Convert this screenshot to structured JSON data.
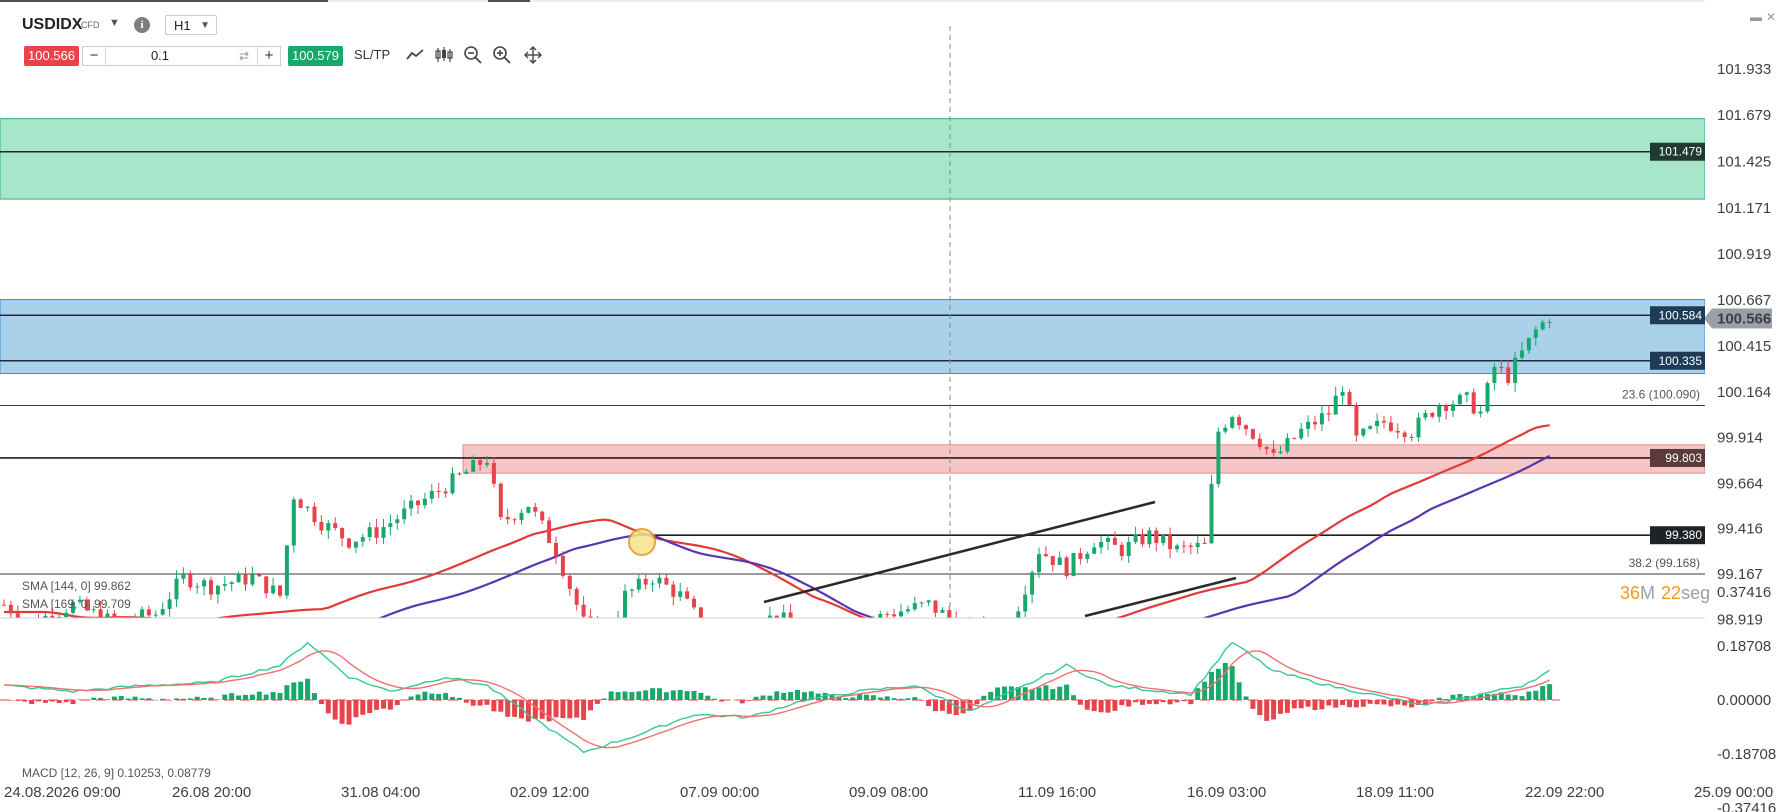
{
  "header": {
    "symbol": "USDIDX",
    "symbol_type": "CFD",
    "timeframe": "H1",
    "sell_price": "100.566",
    "quantity": "0.1",
    "buy_price": "100.579",
    "sltp_label": "SL/TP",
    "icons": [
      "line-chart-icon",
      "candles-icon",
      "zoom-out-icon",
      "zoom-in-icon",
      "move-icon"
    ]
  },
  "window": {
    "icons": [
      "minimize-icon",
      "close-icon"
    ]
  },
  "countdown": {
    "minutes": "36",
    "minutes_unit": "M",
    "seconds": "22",
    "seconds_unit": "seg"
  },
  "indicators": {
    "sma1": "SMA [144, 0] 99.862",
    "sma2": "SMA [169, 0] 99.709",
    "macd": "MACD [12, 26, 9] 0.10253, 0.08779"
  },
  "fib": {
    "f236": "23.6 (100.090)",
    "f382": "38.2 (99.168)"
  },
  "colors": {
    "up": "#17a86b",
    "down": "#e8434a",
    "sma144": "#e23a3a",
    "sma169": "#5a35b0",
    "zone_green": "#a8e6cc",
    "zone_blue": "#a9d1ea",
    "zone_red": "#f6c6c6"
  },
  "chart_data": {
    "type": "candlestick",
    "instrument": "USDIDX",
    "price_axis_ticks": [
      "101.933",
      "101.679",
      "101.425",
      "101.171",
      "100.919",
      "100.667",
      "100.415",
      "100.164",
      "99.914",
      "99.664",
      "99.416",
      "99.167",
      "98.919"
    ],
    "macd_axis_ticks": [
      "0.37416",
      "0.18708",
      "0.00000",
      "-0.18708",
      "-0.37416"
    ],
    "x_ticks": [
      "24.08.2026 09:00",
      "26.08 20:00",
      "31.08 04:00",
      "02.09 12:00",
      "07.09 00:00",
      "09.09 08:00",
      "11.09 16:00",
      "16.09 03:00",
      "18.09 11:00",
      "22.09 22:00",
      "25.09 00:00"
    ],
    "current_price": "100.566",
    "zones": [
      {
        "name": "resistance-zone-upper",
        "from": 101.22,
        "to": 101.66,
        "level": "101.479"
      },
      {
        "name": "resistance-zone-lower",
        "from": 100.265,
        "to": 100.67,
        "levels": [
          "100.584",
          "100.335"
        ]
      },
      {
        "name": "support-zone",
        "from": 99.72,
        "to": 99.875,
        "level": "99.803"
      }
    ],
    "horizontal_levels": [
      "101.479",
      "100.584",
      "100.335",
      "99.803",
      "99.380"
    ],
    "fibonacci": [
      {
        "level": "23.6",
        "price": 100.09
      },
      {
        "level": "38.2",
        "price": 99.168
      }
    ],
    "price_anchors": [
      {
        "t": 0,
        "p": 99.0
      },
      {
        "t": 4,
        "p": 98.9
      },
      {
        "t": 10,
        "p": 99.0
      },
      {
        "t": 16,
        "p": 98.9
      },
      {
        "t": 22,
        "p": 98.95
      },
      {
        "t": 26,
        "p": 99.15
      },
      {
        "t": 30,
        "p": 99.1
      },
      {
        "t": 36,
        "p": 99.15
      },
      {
        "t": 40,
        "p": 99.05
      },
      {
        "t": 42,
        "p": 99.6
      },
      {
        "t": 46,
        "p": 99.45
      },
      {
        "t": 50,
        "p": 99.35
      },
      {
        "t": 54,
        "p": 99.4
      },
      {
        "t": 58,
        "p": 99.5
      },
      {
        "t": 62,
        "p": 99.6
      },
      {
        "t": 66,
        "p": 99.7
      },
      {
        "t": 70,
        "p": 99.8
      },
      {
        "t": 72,
        "p": 99.45
      },
      {
        "t": 76,
        "p": 99.55
      },
      {
        "t": 80,
        "p": 99.3
      },
      {
        "t": 84,
        "p": 98.9
      },
      {
        "t": 88,
        "p": 98.85
      },
      {
        "t": 90,
        "p": 99.05
      },
      {
        "t": 94,
        "p": 99.15
      },
      {
        "t": 98,
        "p": 99.05
      },
      {
        "t": 102,
        "p": 98.85
      },
      {
        "t": 108,
        "p": 98.85
      },
      {
        "t": 112,
        "p": 98.95
      },
      {
        "t": 116,
        "p": 98.8
      },
      {
        "t": 122,
        "p": 98.85
      },
      {
        "t": 128,
        "p": 98.95
      },
      {
        "t": 134,
        "p": 99.0
      },
      {
        "t": 140,
        "p": 98.85
      },
      {
        "t": 146,
        "p": 98.9
      },
      {
        "t": 150,
        "p": 99.3
      },
      {
        "t": 154,
        "p": 99.2
      },
      {
        "t": 158,
        "p": 99.35
      },
      {
        "t": 162,
        "p": 99.3
      },
      {
        "t": 166,
        "p": 99.38
      },
      {
        "t": 170,
        "p": 99.3
      },
      {
        "t": 174,
        "p": 99.32
      },
      {
        "t": 176,
        "p": 99.95
      },
      {
        "t": 178,
        "p": 100.05
      },
      {
        "t": 182,
        "p": 99.9
      },
      {
        "t": 184,
        "p": 99.8
      },
      {
        "t": 188,
        "p": 99.95
      },
      {
        "t": 192,
        "p": 100.05
      },
      {
        "t": 194,
        "p": 100.2
      },
      {
        "t": 196,
        "p": 99.9
      },
      {
        "t": 200,
        "p": 100.0
      },
      {
        "t": 204,
        "p": 99.95
      },
      {
        "t": 208,
        "p": 100.1
      },
      {
        "t": 212,
        "p": 100.12
      },
      {
        "t": 214,
        "p": 100.05
      },
      {
        "t": 216,
        "p": 100.3
      },
      {
        "t": 218,
        "p": 100.25
      },
      {
        "t": 222,
        "p": 100.5
      },
      {
        "t": 224,
        "p": 100.58
      }
    ],
    "macd_anchors": [
      {
        "t": 0,
        "v": 0.05
      },
      {
        "t": 10,
        "v": 0.03
      },
      {
        "t": 20,
        "v": 0.05
      },
      {
        "t": 30,
        "v": 0.06
      },
      {
        "t": 40,
        "v": 0.12
      },
      {
        "t": 44,
        "v": 0.2
      },
      {
        "t": 50,
        "v": 0.08
      },
      {
        "t": 56,
        "v": 0.03
      },
      {
        "t": 64,
        "v": 0.08
      },
      {
        "t": 70,
        "v": 0.05
      },
      {
        "t": 76,
        "v": -0.05
      },
      {
        "t": 84,
        "v": -0.18
      },
      {
        "t": 92,
        "v": -0.12
      },
      {
        "t": 100,
        "v": -0.05
      },
      {
        "t": 108,
        "v": -0.06
      },
      {
        "t": 116,
        "v": 0.0
      },
      {
        "t": 124,
        "v": 0.03
      },
      {
        "t": 132,
        "v": 0.05
      },
      {
        "t": 140,
        "v": -0.04
      },
      {
        "t": 148,
        "v": 0.05
      },
      {
        "t": 154,
        "v": 0.12
      },
      {
        "t": 160,
        "v": 0.05
      },
      {
        "t": 168,
        "v": 0.03
      },
      {
        "t": 172,
        "v": 0.02
      },
      {
        "t": 178,
        "v": 0.2
      },
      {
        "t": 184,
        "v": 0.1
      },
      {
        "t": 192,
        "v": 0.05
      },
      {
        "t": 198,
        "v": 0.02
      },
      {
        "t": 206,
        "v": -0.02
      },
      {
        "t": 214,
        "v": 0.02
      },
      {
        "t": 220,
        "v": 0.05
      },
      {
        "t": 224,
        "v": 0.1
      }
    ]
  }
}
